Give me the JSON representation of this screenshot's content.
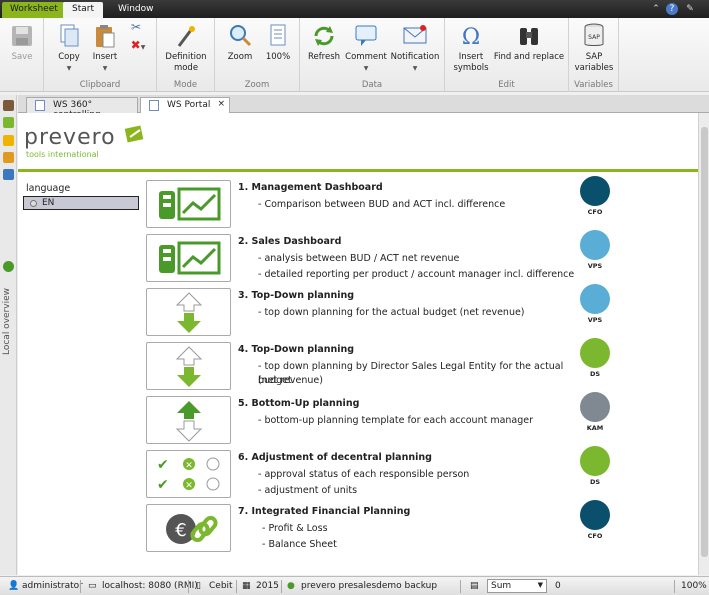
{
  "menubar": {
    "tabs": [
      "Worksheet",
      "Start",
      "Window"
    ]
  },
  "ribbon": {
    "groups": {
      "clipboard": "Clipboard",
      "mode": "Mode",
      "zoom": "Zoom",
      "data": "Data",
      "edit": "Edit",
      "variables": "Variables"
    },
    "buttons": {
      "save": "Save",
      "copy": "Copy",
      "insert": "Insert",
      "definition_mode_1": "Definition",
      "definition_mode_2": "mode",
      "zoom": "Zoom",
      "zoom100": "100%",
      "refresh": "Refresh",
      "comment": "Comment",
      "notification": "Notification",
      "insert_symbols_1": "Insert",
      "insert_symbols_2": "symbols",
      "find_replace": "Find and replace",
      "sap_variables_1": "SAP",
      "sap_variables_2": "variables",
      "sap_icon_text": "SAP"
    }
  },
  "left_panel": {
    "label": "Local overview"
  },
  "doc_tabs": [
    {
      "label": "WS 360° controlling"
    },
    {
      "label": "WS Portal",
      "close": "×"
    }
  ],
  "logo": {
    "brand": "prevero",
    "tagline": "tools international"
  },
  "language": {
    "label": "language",
    "selected": "EN"
  },
  "items": [
    {
      "title": "1. Management Dashboard",
      "lines": [
        "- Comparison between BUD and ACT incl. difference"
      ],
      "role": "CFO",
      "role_color": "#0a4f6b"
    },
    {
      "title": "2. Sales Dashboard",
      "lines": [
        "- analysis between BUD / ACT net revenue",
        "- detailed reporting per product / account manager incl. difference"
      ],
      "role": "VPS",
      "role_color": "#5aaed5"
    },
    {
      "title": "3. Top-Down planning",
      "lines": [
        "- top down planning  for the actual budget (net revenue)"
      ],
      "role": "VPS",
      "role_color": "#5aaed5"
    },
    {
      "title": "4. Top-Down planning",
      "lines": [
        "- top down planning by Director Sales Legal Entity for the actual budget",
        "(net revenue)"
      ],
      "role": "DS",
      "role_color": "#7cb82f"
    },
    {
      "title": "5. Bottom-Up planning",
      "lines": [
        "- bottom-up planning template for each account manager"
      ],
      "role": "KAM",
      "role_color": "#808891"
    },
    {
      "title": "6. Adjustment of decentral planning",
      "lines": [
        "- approval status of each responsible person",
        "- adjustment of units"
      ],
      "role": "DS",
      "role_color": "#7cb82f"
    },
    {
      "title": "7. Integrated Financial Planning",
      "lines": [
        "- Profit & Loss",
        "- Balance Sheet"
      ],
      "role": "CFO",
      "role_color": "#0a4f6b"
    }
  ],
  "status": {
    "user": "administrator",
    "server": "localhost: 8080 (RMI)",
    "company": "Cebit",
    "year": "2015",
    "db": "prevero presalesdemo backup",
    "agg": "Sum",
    "value": "0",
    "zoom": "100%"
  },
  "colors": {
    "accent": "#8bb51d"
  }
}
